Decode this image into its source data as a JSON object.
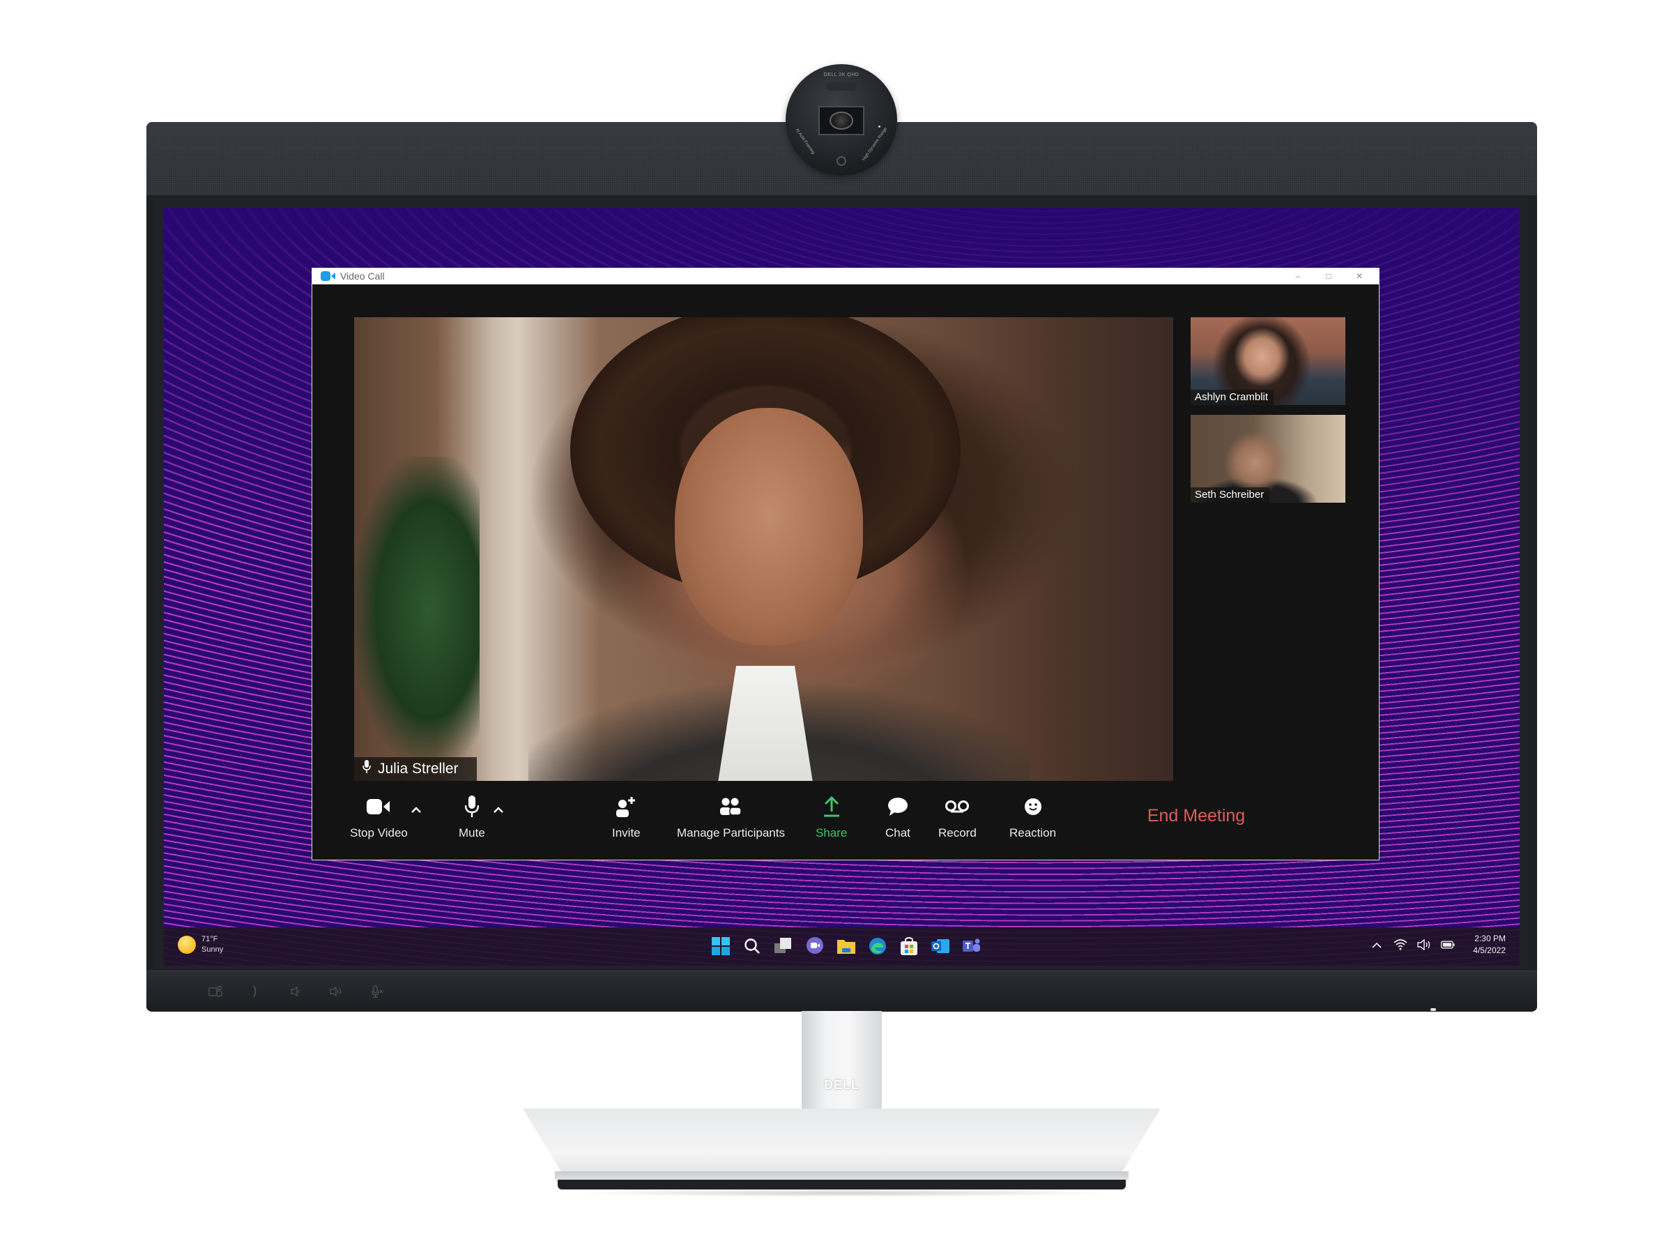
{
  "device": {
    "webcam_text_top": "DELL   2K QHD",
    "webcam_text_left": "AI Auto Framing",
    "webcam_text_right": "High Dynamic Range",
    "stand_logo": "DELL",
    "bezel_buttons": [
      {
        "icon": "teams-icon"
      },
      {
        "icon": "phone-icon"
      },
      {
        "icon": "volume-down-icon"
      },
      {
        "icon": "volume-up-icon"
      },
      {
        "icon": "mic-mute-icon"
      }
    ]
  },
  "window": {
    "title": "Video Call",
    "controls": {
      "minimize": "–",
      "maximize": "□",
      "close": "✕"
    }
  },
  "main_video": {
    "participant_name": "Julia Streller"
  },
  "thumbnails": [
    {
      "name": "Ashlyn Cramblit"
    },
    {
      "name": "Seth Schreiber"
    }
  ],
  "toolbar": {
    "stop_video": "Stop Video",
    "mute": "Mute",
    "invite": "Invite",
    "manage_participants": "Manage Participants",
    "share": "Share",
    "chat": "Chat",
    "record": "Record",
    "reaction": "Reaction",
    "end_meeting": "End Meeting"
  },
  "colors": {
    "share_accent": "#3ec46d",
    "end_meeting": "#e05b5b",
    "app_icon": "#1e9ce8"
  },
  "taskbar": {
    "weather": {
      "temp": "71°F",
      "condition": "Sunny"
    },
    "apps": [
      "start-icon",
      "search-icon",
      "task-view-icon",
      "chat-icon",
      "file-explorer-icon",
      "edge-icon",
      "store-icon",
      "outlook-icon",
      "teams-icon"
    ],
    "clock": {
      "time": "2:30 PM",
      "date": "4/5/2022"
    }
  }
}
